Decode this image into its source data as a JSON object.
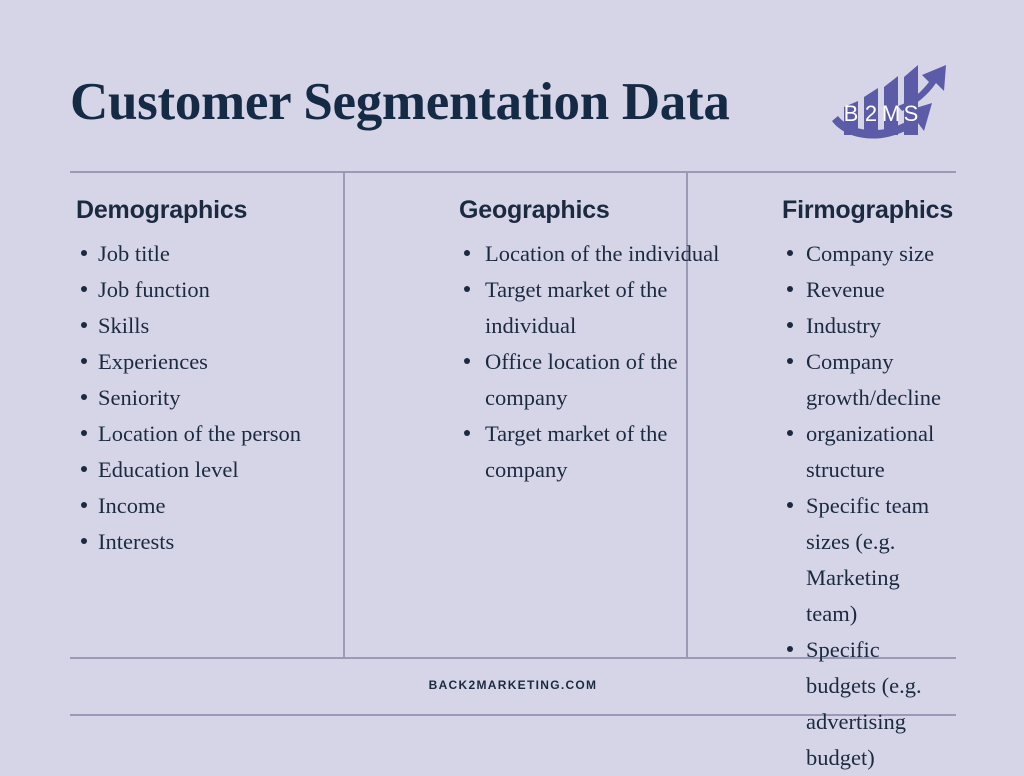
{
  "header": {
    "title": "Customer Segmentation Data",
    "logo": {
      "text": "B2MS",
      "letters": [
        "B",
        "2",
        "M",
        "S"
      ],
      "bar_color": "#5b5ba8",
      "arrow_color": "#5b5ba8",
      "letter_color": "#ffffff"
    }
  },
  "theme": {
    "background": "#d6d5e8",
    "text_color": "#1b2a41",
    "title_color": "#152a45",
    "rule_color": "#9a99b8"
  },
  "columns": [
    {
      "heading": "Demographics",
      "items": [
        "Job title",
        "Job function",
        "Skills",
        "Experiences",
        "Seniority",
        "Location of the person",
        "Education level",
        "Income",
        "Interests"
      ]
    },
    {
      "heading": "Geographics",
      "items": [
        "Location of the individual",
        "Target market of the individual",
        "Office location of the company",
        "Target market of the company"
      ]
    },
    {
      "heading": "Firmographics",
      "items": [
        "Company size",
        "Revenue",
        "Industry",
        "Company growth/decline",
        "organizational structure",
        "Specific team sizes (e.g. Marketing team)",
        "Specific budgets (e.g. advertising budget)"
      ]
    }
  ],
  "footer": {
    "text": "BACK2MARKETING.COM"
  }
}
